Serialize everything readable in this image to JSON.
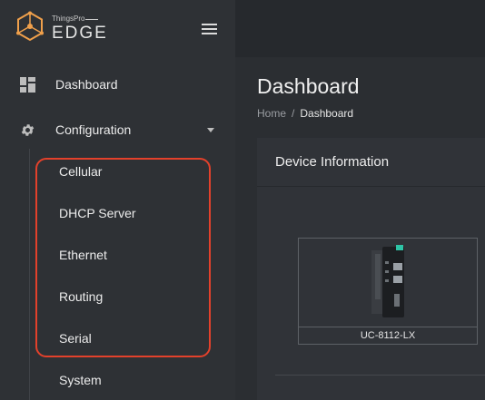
{
  "brand": {
    "small_text": "ThingsPro",
    "product": "EDGE"
  },
  "sidebar": {
    "items": [
      {
        "label": "Dashboard",
        "icon": "dashboard-icon"
      },
      {
        "label": "Configuration",
        "icon": "gear-icon",
        "expanded": true
      }
    ],
    "submenu": [
      {
        "label": "Cellular"
      },
      {
        "label": "DHCP Server"
      },
      {
        "label": "Ethernet"
      },
      {
        "label": "Routing"
      },
      {
        "label": "Serial"
      },
      {
        "label": "System"
      }
    ]
  },
  "main": {
    "title": "Dashboard",
    "breadcrumb": {
      "home": "Home",
      "separator": "/",
      "current": "Dashboard"
    },
    "card": {
      "title": "Device Information",
      "device_model": "UC-8112-LX"
    }
  },
  "colors": {
    "accent": "#f0a04b",
    "highlight": "#e3412b",
    "background": "#2b2e32"
  }
}
